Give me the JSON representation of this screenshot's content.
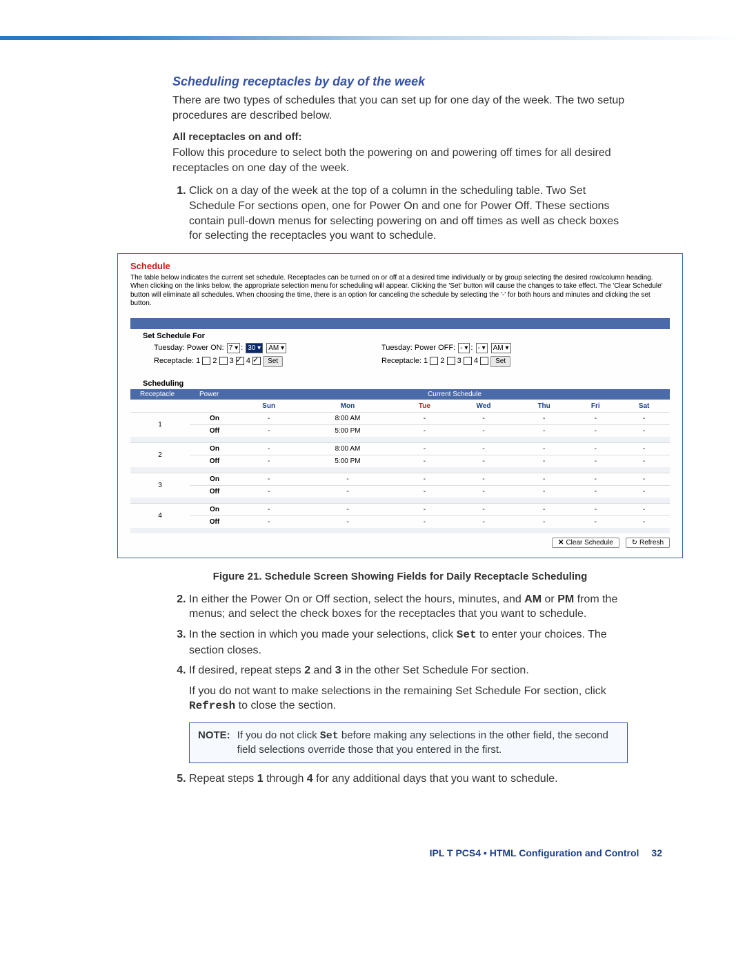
{
  "section": {
    "title": "Scheduling receptacles by day of the week",
    "intro": "There are two types of schedules that you can set up for one day of the week. The two setup procedures are described below.",
    "sub_heading": "All receptacles on and off:",
    "sub_intro": "Follow this procedure to select both the powering on and powering off times for all desired receptacles on one day of the week.",
    "step1": "Click on a day of the week at the top of a column in the scheduling table. Two Set Schedule For sections open, one for Power On and one for Power Off. These sections contain pull-down menus for selecting powering on and off times as well as check boxes for selecting the receptacles you want to schedule."
  },
  "figure": {
    "title": "Schedule",
    "desc": "The table below indicates the current set schedule. Receptacles can be turned on or off at a desired time individually or by group selecting the desired row/column heading. When clicking on the links below, the appropriate selection menu for scheduling will appear. Clicking the 'Set' button will cause the changes to take effect. The 'Clear Schedule' button will eliminate all schedules. When choosing the time, there is an option for canceling the schedule by selecting the '-' for both hours and minutes and clicking the set button.",
    "set_label": "Set Schedule For",
    "on": {
      "prefix": "Tuesday: Power ON:",
      "hour": "7",
      "min": "30",
      "ampm": "AM",
      "recpt_label": "Receptacle:",
      "checks": [
        false,
        false,
        true,
        true
      ],
      "set": "Set"
    },
    "off": {
      "prefix": "Tuesday: Power OFF:",
      "hour": "-",
      "min": "-",
      "ampm": "AM",
      "recpt_label": "Receptacle:",
      "checks": [
        false,
        false,
        false,
        false
      ],
      "set": "Set"
    },
    "scheduling_label": "Scheduling",
    "headers": {
      "receptacle": "Receptacle",
      "power": "Power",
      "cur": "Current Schedule"
    },
    "days": [
      "Sun",
      "Mon",
      "Tue",
      "Wed",
      "Thu",
      "Fri",
      "Sat"
    ],
    "rows": [
      {
        "num": "1",
        "on": [
          "-",
          "8:00 AM",
          "-",
          "-",
          "-",
          "-",
          "-"
        ],
        "off": [
          "-",
          "5:00 PM",
          "-",
          "-",
          "-",
          "-",
          "-"
        ]
      },
      {
        "num": "2",
        "on": [
          "-",
          "8:00 AM",
          "-",
          "-",
          "-",
          "-",
          "-"
        ],
        "off": [
          "-",
          "5:00 PM",
          "-",
          "-",
          "-",
          "-",
          "-"
        ]
      },
      {
        "num": "3",
        "on": [
          "-",
          "-",
          "-",
          "-",
          "-",
          "-",
          "-"
        ],
        "off": [
          "-",
          "-",
          "-",
          "-",
          "-",
          "-",
          "-"
        ]
      },
      {
        "num": "4",
        "on": [
          "-",
          "-",
          "-",
          "-",
          "-",
          "-",
          "-"
        ],
        "off": [
          "-",
          "-",
          "-",
          "-",
          "-",
          "-",
          "-"
        ]
      }
    ],
    "on_label": "On",
    "off_label": "Off",
    "clear_btn": "Clear Schedule",
    "refresh_btn": "Refresh",
    "caption_prefix": "Figure 21.",
    "caption": " Schedule Screen Showing Fields for Daily Receptacle Scheduling"
  },
  "steps_after": {
    "step2a": "In either the Power On or Off section, select the hours, minutes, and ",
    "am_label": "AM",
    "or": " or ",
    "pm_label": "PM",
    "step2b": " from the menus; and select the check boxes for the receptacles that you want to schedule.",
    "step3a": "In the section in which you made your selections, click ",
    "set_mono": "Set",
    "step3b": " to enter your choices. The section closes.",
    "step4a": "If desired, repeat steps ",
    "b2": "2",
    "and": " and ",
    "b3": "3",
    "step4b": " in the other Set Schedule For section.",
    "step4c": "If you do not want to make selections in the remaining Set Schedule For section, click ",
    "refresh_mono": "Refresh",
    "step4d": " to close the section.",
    "note_label": "NOTE:",
    "note_a": "If you do not click ",
    "note_set": "Set",
    "note_b": " before making any selections in the other field, the second field selections override those that you entered in the first.",
    "step5a": "Repeat steps ",
    "b1": "1",
    "thru": " through ",
    "b4": "4",
    "step5b": " for any additional days that you want to schedule."
  },
  "footer": {
    "text": "IPL T PCS4 • HTML Configuration and Control",
    "page": "32"
  }
}
